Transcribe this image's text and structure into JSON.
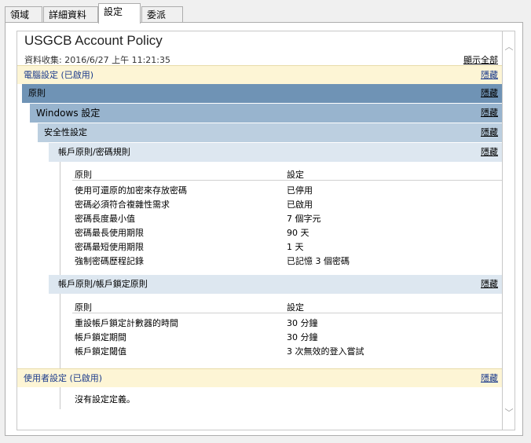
{
  "tabs": [
    "領域",
    "詳細資料",
    "設定",
    "委派"
  ],
  "active_tab": "設定",
  "report": {
    "title": "USGCB Account Policy",
    "collected": "資料收集: 2016/6/27 上午 11:21:35",
    "show_all": "顯示全部",
    "hide": "隱藏",
    "computer_section": "電腦設定 (已啟用)",
    "policy_section": "原則",
    "windows_section": "Windows 設定",
    "security_section": "安全性設定",
    "password_section": "帳戶原則/密碼規則",
    "lockout_section": "帳戶原則/帳戶鎖定原則",
    "user_section": "使用者設定 (已啟用)",
    "no_settings": "沒有設定定義。",
    "col_policy": "原則",
    "col_setting": "設定",
    "password_rows": [
      {
        "policy": "使用可還原的加密來存放密碼",
        "setting": "已停用"
      },
      {
        "policy": "密碼必須符合複雜性需求",
        "setting": "已啟用"
      },
      {
        "policy": "密碼長度最小值",
        "setting": "7 個字元"
      },
      {
        "policy": "密碼最長使用期限",
        "setting": "90 天"
      },
      {
        "policy": "密碼最短使用期限",
        "setting": "1 天"
      },
      {
        "policy": "強制密碼歷程記錄",
        "setting": "已記憶 3 個密碼"
      }
    ],
    "lockout_rows": [
      {
        "policy": "重設帳戶鎖定計數器的時間",
        "setting": "30 分鐘"
      },
      {
        "policy": "帳戶鎖定期間",
        "setting": "30 分鐘"
      },
      {
        "policy": "帳戶鎖定閾值",
        "setting": "3 次無效的登入嘗試"
      }
    ]
  },
  "scrollbar": {
    "up": "︿",
    "down": "﹀"
  }
}
